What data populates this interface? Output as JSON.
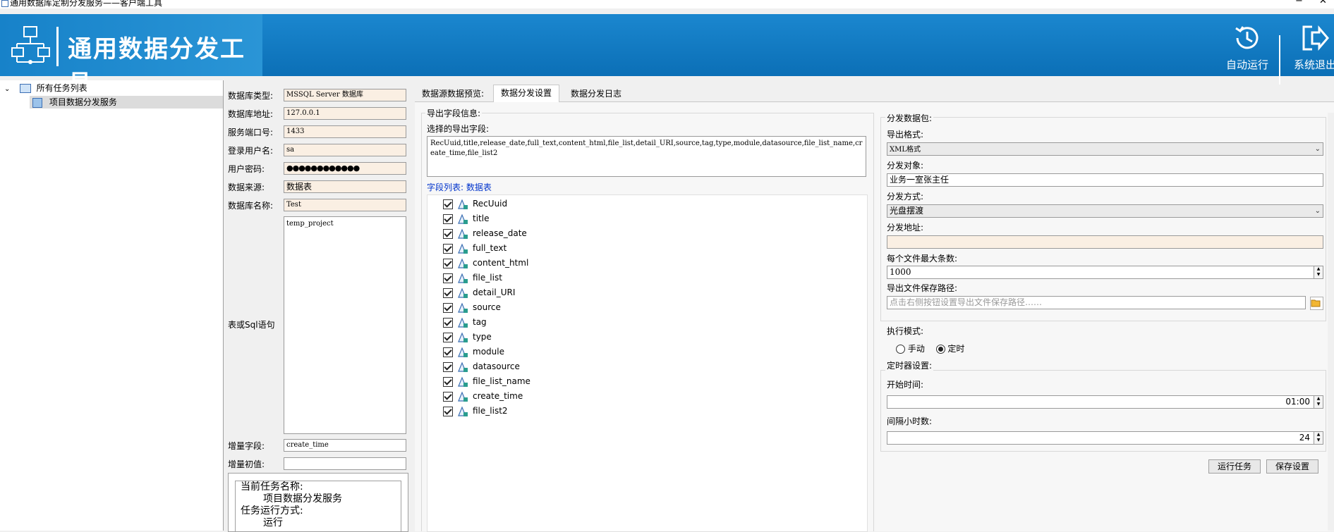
{
  "window": {
    "title": "通用数据库定制分发服务——客户端工具",
    "controls": [
      "−",
      "✕"
    ]
  },
  "header": {
    "app_title": "通用数据分发工具",
    "auto_run_label": "自动运行",
    "exit_label": "系统退出"
  },
  "tree": {
    "root_label": "所有任务列表",
    "items": [
      {
        "label": "项目数据分发服务",
        "selected": true
      }
    ]
  },
  "db_form": {
    "db_type_label": "数据库类型:",
    "db_type_value": "MSSQL Server 数据库",
    "db_address_label": "数据库地址:",
    "db_address_value": "127.0.0.1",
    "port_label": "服务端口号:",
    "port_value": "1433",
    "username_label": "登录用户名:",
    "username_value": "sa",
    "password_label": "用户密码:",
    "password_value": "●●●●●●●●●●●●",
    "source_label": "数据来源:",
    "source_value": "数据表",
    "db_name_label": "数据库名称:",
    "db_name_value": "Test",
    "sql_label": "表或Sql语句",
    "sql_value": "temp_project",
    "incr_field_label": "增量字段:",
    "incr_field_value": "create_time",
    "incr_init_label": "增量初值:",
    "incr_init_value": ""
  },
  "task_info": {
    "name_label": "当前任务名称:",
    "name_value": "项目数据分发服务",
    "mode_label": "任务运行方式:",
    "mode_value": "运行"
  },
  "tabs": [
    {
      "label": "数据源数据预览:",
      "active": false
    },
    {
      "label": "数据分发设置",
      "active": true
    },
    {
      "label": "数据分发日志",
      "active": false
    }
  ],
  "export": {
    "group_label": "导出字段信息:",
    "selected_label": "选择的导出字段:",
    "selected_value": "RecUuid,title,release_date,full_text,content_html,file_list,detail_URI,source,tag,type,module,datasource,file_list_name,create_time,file_list2",
    "list_label_prefix": "字段列表:",
    "list_label_name": "数据表",
    "fields": [
      {
        "name": "RecUuid",
        "checked": true
      },
      {
        "name": "title",
        "checked": true
      },
      {
        "name": "release_date",
        "checked": true
      },
      {
        "name": "full_text",
        "checked": true
      },
      {
        "name": "content_html",
        "checked": true
      },
      {
        "name": "file_list",
        "checked": true
      },
      {
        "name": "detail_URI",
        "checked": true
      },
      {
        "name": "source",
        "checked": true
      },
      {
        "name": "tag",
        "checked": true
      },
      {
        "name": "type",
        "checked": true
      },
      {
        "name": "module",
        "checked": true
      },
      {
        "name": "datasource",
        "checked": true
      },
      {
        "name": "file_list_name",
        "checked": true
      },
      {
        "name": "create_time",
        "checked": true
      },
      {
        "name": "file_list2",
        "checked": true
      }
    ]
  },
  "distribution": {
    "group_label": "分发数据包:",
    "format_label": "导出格式:",
    "format_value": "XML格式",
    "target_label": "分发对象:",
    "target_value": "业务一室张主任",
    "method_label": "分发方式:",
    "method_value": "光盘摆渡",
    "address_label": "分发地址:",
    "address_value": "",
    "max_records_label": "每个文件最大条数:",
    "max_records_value": "1000",
    "save_path_label": "导出文件保存路径:",
    "save_path_placeholder": "点击右侧按钮设置导出文件保存路径……"
  },
  "execution": {
    "mode_label": "执行模式:",
    "manual_label": "手动",
    "scheduled_label": "定时",
    "selected": "定时"
  },
  "timer": {
    "group_label": "定时器设置:",
    "start_label": "开始时间:",
    "start_value": "01:00",
    "interval_label": "间隔小时数:",
    "interval_value": "24"
  },
  "actions": {
    "run_label": "运行任务",
    "save_label": "保存设置"
  },
  "colors": {
    "banner": "#0b6fb6",
    "field_bg": "#faefe3",
    "link": "#0033cc"
  }
}
